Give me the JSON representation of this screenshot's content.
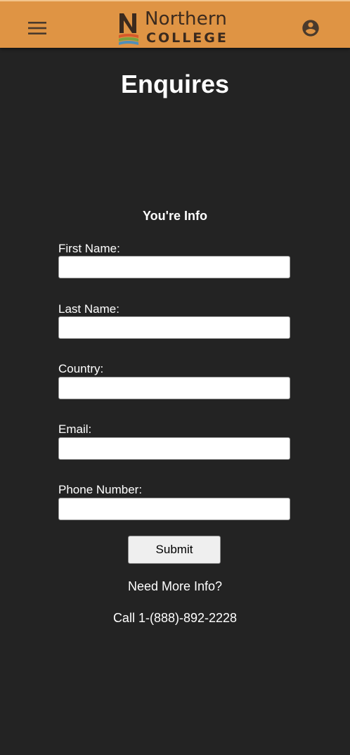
{
  "header": {
    "brand_line1": "Northern",
    "brand_line2": "COLLEGE",
    "menu_icon": "hamburger-menu-icon",
    "account_icon": "account-circle-icon",
    "bar_color": "#df9444"
  },
  "page": {
    "title": "Enquires",
    "section_title": "You're Info"
  },
  "form": {
    "fields": [
      {
        "label": "First Name:",
        "value": ""
      },
      {
        "label": "Last Name:",
        "value": ""
      },
      {
        "label": "Country:",
        "value": ""
      },
      {
        "label": "Email:",
        "value": ""
      },
      {
        "label": "Phone Number:",
        "value": ""
      }
    ],
    "submit_label": "Submit"
  },
  "contact": {
    "heading": "Need More Info?",
    "phone_text": "Call 1-(888)-892-2228"
  }
}
